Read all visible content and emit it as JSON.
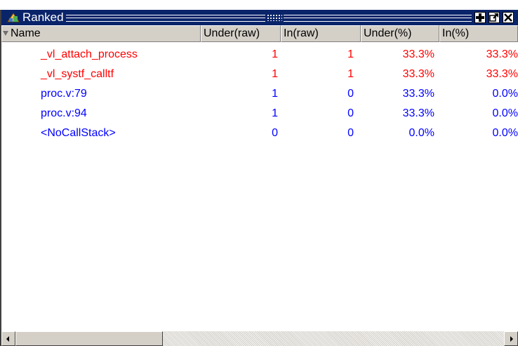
{
  "window": {
    "title": "Ranked"
  },
  "columns": [
    {
      "label": "Name"
    },
    {
      "label": "Under(raw)"
    },
    {
      "label": "In(raw)"
    },
    {
      "label": "Under(%)"
    },
    {
      "label": "In(%)"
    }
  ],
  "rows": [
    {
      "name": "_vl_attach_process",
      "under_raw": "1",
      "in_raw": "1",
      "under_pct": "33.3%",
      "in_pct": "33.3%",
      "color": "#ff0000"
    },
    {
      "name": "_vl_systf_calltf",
      "under_raw": "1",
      "in_raw": "1",
      "under_pct": "33.3%",
      "in_pct": "33.3%",
      "color": "#ff0000"
    },
    {
      "name": "proc.v:79",
      "under_raw": "1",
      "in_raw": "0",
      "under_pct": "33.3%",
      "in_pct": "0.0%",
      "color": "#0000ff"
    },
    {
      "name": "proc.v:94",
      "under_raw": "1",
      "in_raw": "0",
      "under_pct": "33.3%",
      "in_pct": "0.0%",
      "color": "#0000ff"
    },
    {
      "name": "<NoCallStack>",
      "under_raw": "0",
      "in_raw": "0",
      "under_pct": "0.0%",
      "in_pct": "0.0%",
      "color": "#0000ff"
    }
  ],
  "icons": {
    "app": "ranked-app-icon",
    "add": "plus-icon",
    "undock": "undock-icon",
    "close": "close-icon",
    "sort": "sort-down-icon"
  },
  "colors": {
    "titlebar": "#0a246a",
    "hot_row": "#ff0000",
    "normal_row": "#0000ff"
  }
}
